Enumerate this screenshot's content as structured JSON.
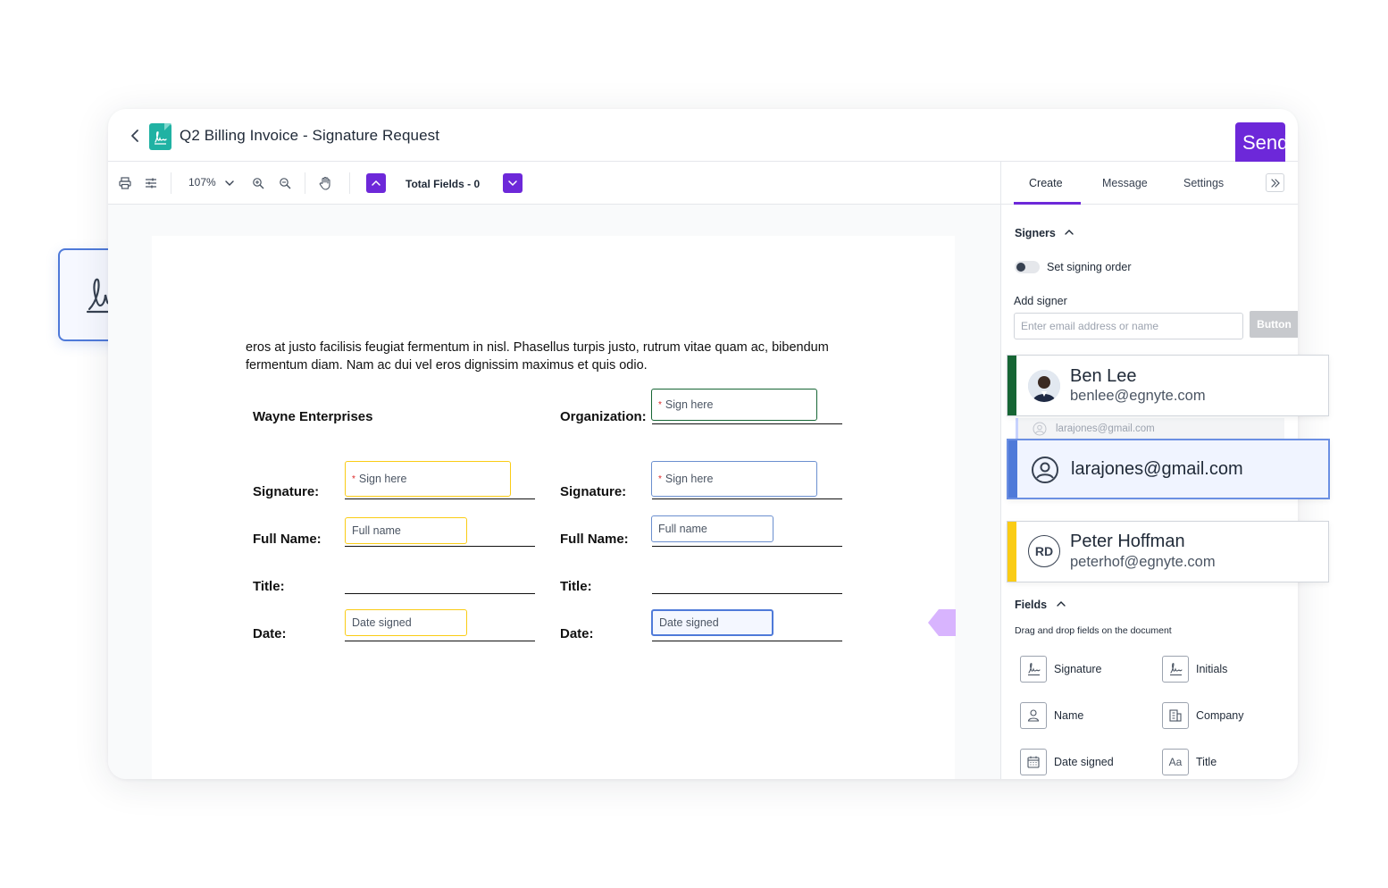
{
  "header": {
    "title": "Q2 Billing Invoice - Signature Request",
    "send_label": "Send"
  },
  "toolbar": {
    "zoom": "107%",
    "total_fields": "Total Fields - 0"
  },
  "document": {
    "body_text": "eros at justo facilisis feugiat fermentum in nisl. Phasellus turpis justo, rutrum vitae quam ac, bibendum fermentum diam. Nam ac dui vel eros dignissim maximus et quis odio.",
    "company": "Wayne Enterprises",
    "labels": {
      "organization": "Organization:",
      "signature": "Signature:",
      "full_name": "Full Name:",
      "title": "Title:",
      "date": "Date:"
    },
    "fields": {
      "sign_here": "Sign here",
      "full_name": "Full name",
      "date_signed": "Date signed"
    }
  },
  "panel": {
    "tabs": [
      "Create",
      "Message",
      "Settings"
    ],
    "active_tab": "Create",
    "signers_title": "Signers",
    "signing_order_label": "Set signing order",
    "add_signer_label": "Add signer",
    "email_placeholder": "Enter email address or name",
    "add_button_label": "Button",
    "fields_title": "Fields",
    "fields_hint": "Drag and drop fields on the document",
    "field_types": [
      {
        "label": "Signature",
        "icon": "signature-icon"
      },
      {
        "label": "Initials",
        "icon": "initials-icon"
      },
      {
        "label": "Name",
        "icon": "person-icon"
      },
      {
        "label": "Company",
        "icon": "building-icon"
      },
      {
        "label": "Date signed",
        "icon": "calendar-icon"
      },
      {
        "label": "Title",
        "icon": "text-aa-icon"
      }
    ]
  },
  "signers": [
    {
      "name": "Ben Lee",
      "email": "benlee@egnyte.com",
      "color": "#166534",
      "avatar": "photo"
    },
    {
      "name": "larajones@gmail.com",
      "email": "",
      "color": "#4f7ad9",
      "avatar": "user-circle-icon"
    },
    {
      "name": "Peter Hoffman",
      "email": "peterhof@egnyte.com",
      "color": "#facc15",
      "avatar_initials": "RD"
    }
  ],
  "ghost_email": "larajones@gmail.com",
  "colors": {
    "accent": "#6d28d9",
    "signer_green": "#166534",
    "signer_blue": "#4f7ad9",
    "signer_yellow": "#facc15"
  }
}
